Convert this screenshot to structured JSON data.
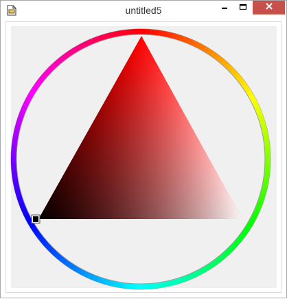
{
  "window": {
    "title": "untitled5",
    "icon": "document-icon",
    "controls": [
      "minimize-icon",
      "maximize-icon",
      "close-icon"
    ],
    "close_color": "#c7504b"
  },
  "color_picker": {
    "type": "hue-ring-triangle",
    "selected_hue_color": "#ff0000",
    "selected_color": "#000000",
    "ring_colors": [
      "#ff0000",
      "#ffff00",
      "#00ff00",
      "#00ffff",
      "#0000ff",
      "#ff00ff"
    ]
  }
}
